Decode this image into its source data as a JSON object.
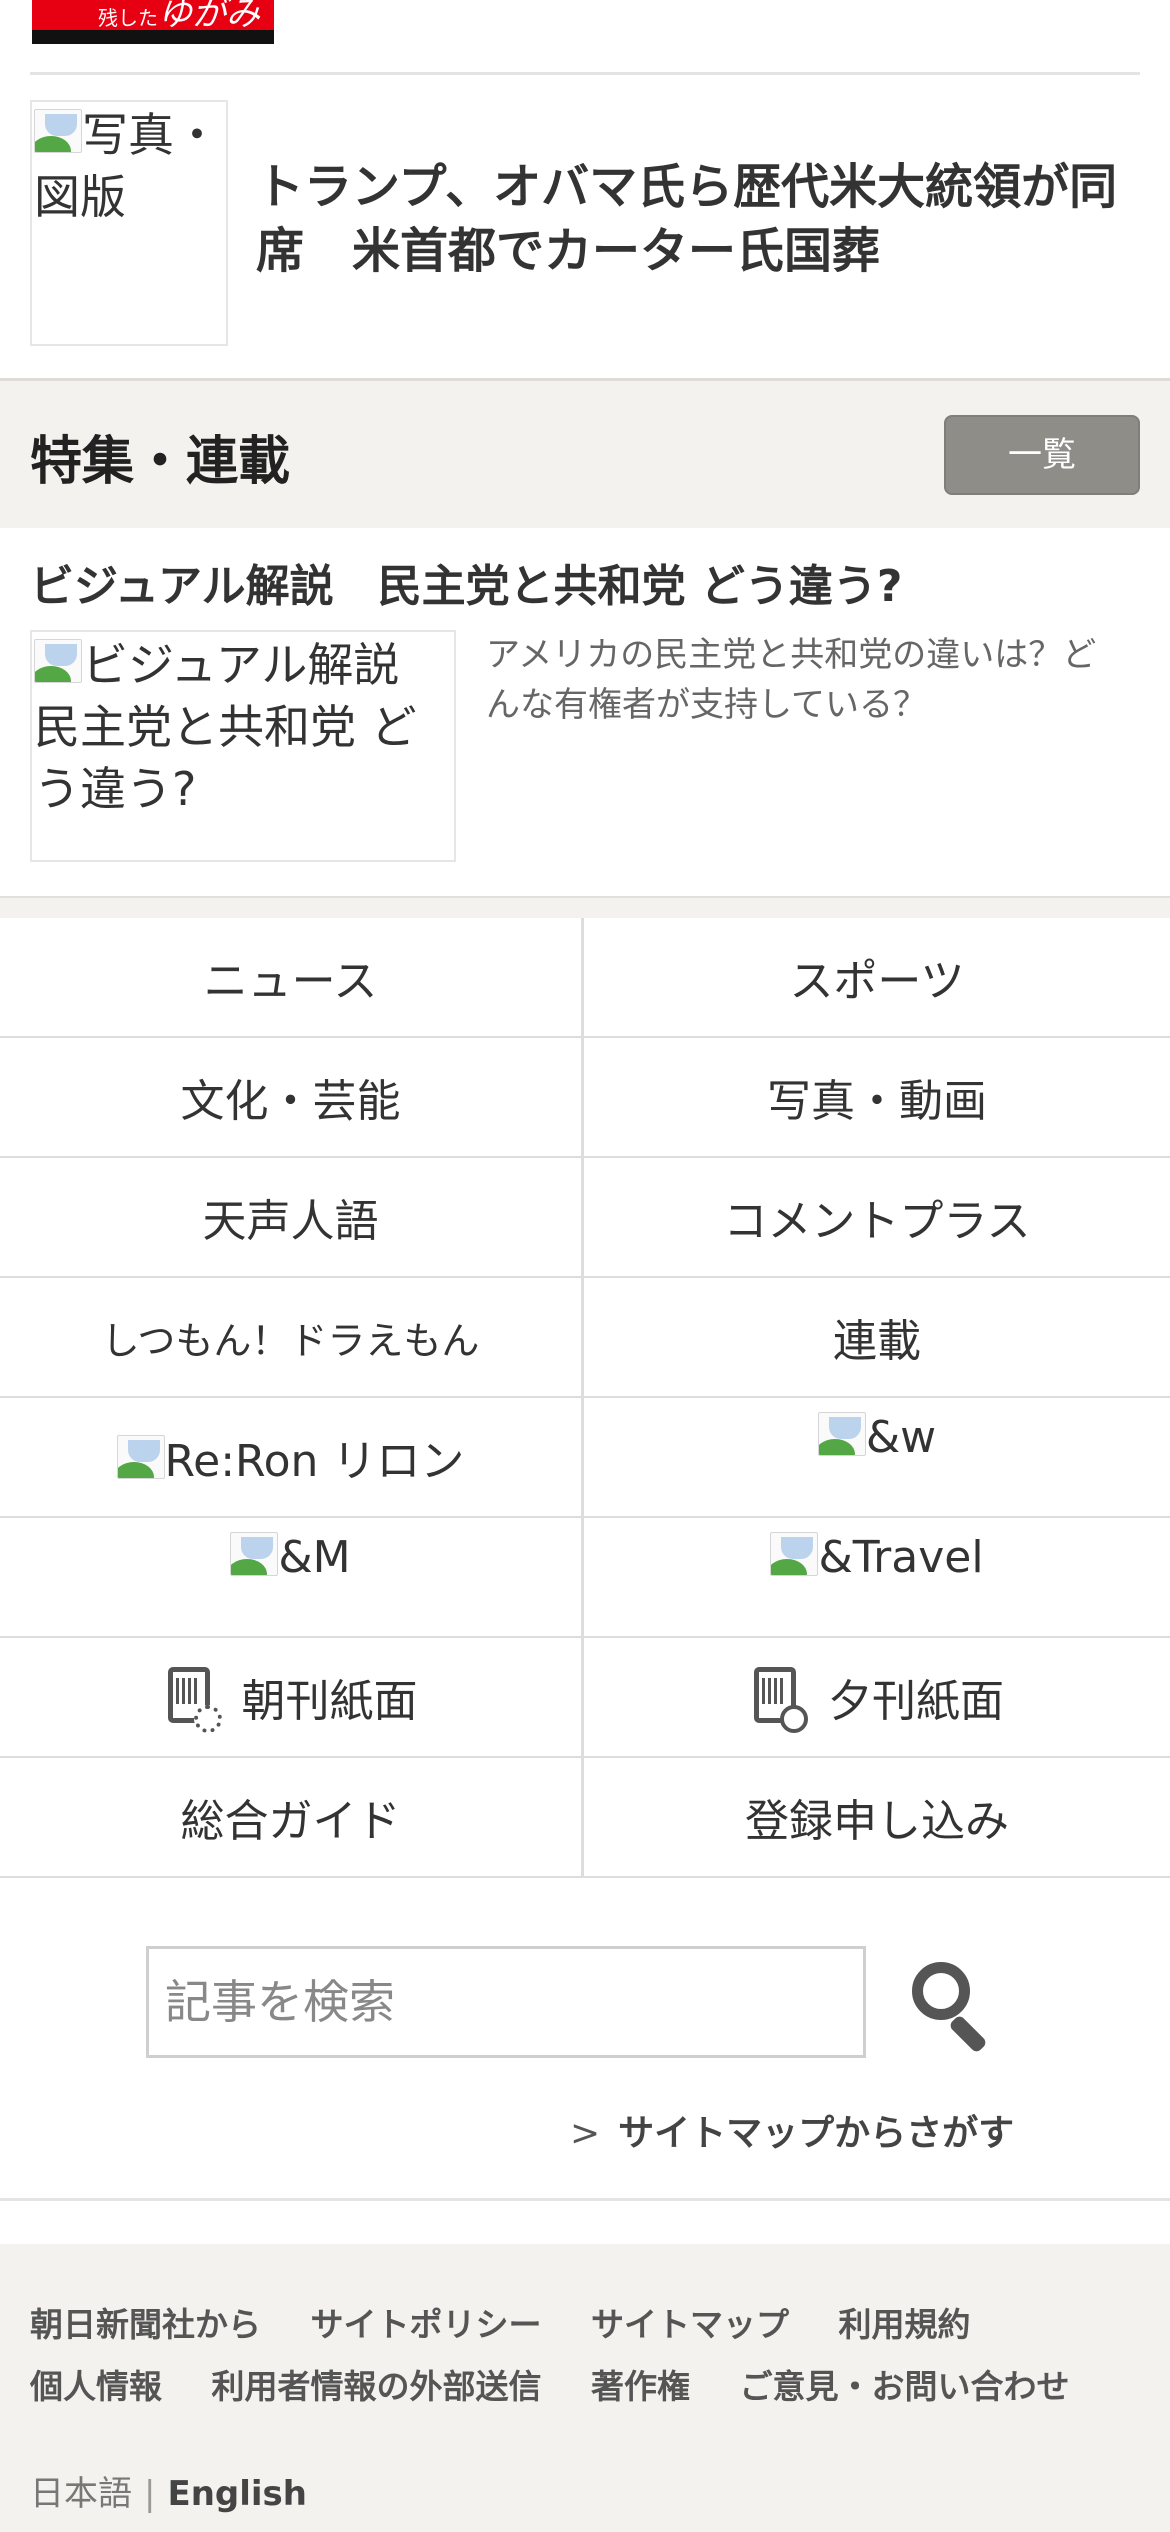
{
  "top_banner": {
    "text_small": "残した",
    "text_large": "ゆがみ"
  },
  "article": {
    "thumb_alt": "写真・図版",
    "headline": "トランプ、オバマ氏ら歴代米大統領が同席　米首都でカーター氏国葬"
  },
  "feature_section": {
    "title": "特集・連載",
    "list_button": "一覧"
  },
  "feature_item": {
    "title": "ビジュアル解説　民主党と共和党 どう違う?",
    "thumb_alt": "ビジュアル解説 民主党と共和党 どう違う?",
    "description": "アメリカの民主党と共和党の違いは？どんな有権者が支持している？"
  },
  "nav": {
    "news": "ニュース",
    "sports": "スポーツ",
    "culture": "文化・芸能",
    "photo_video": "写真・動画",
    "tensei_jingo": "天声人語",
    "comment_plus": "コメントプラス",
    "shitsumon": "しつもん！ドラえもん",
    "rensai": "連載",
    "reron": "Re:Ron リロン",
    "and_w": "&w",
    "and_m": "&M",
    "and_travel": "&Travel",
    "morning_paper": "朝刊紙面",
    "evening_paper": "夕刊紙面",
    "guide": "総合ガイド",
    "register": "登録申し込み"
  },
  "search": {
    "placeholder": "記事を検索",
    "sitemap_link": "サイトマップからさがす"
  },
  "footer": {
    "links": [
      "朝日新聞社から",
      "サイトポリシー",
      "サイトマップ",
      "利用規約",
      "個人情報",
      "利用者情報の外部送信",
      "著作権",
      "ご意見・お問い合わせ"
    ],
    "lang_ja": "日本語",
    "lang_sep": "|",
    "lang_en": "English"
  }
}
